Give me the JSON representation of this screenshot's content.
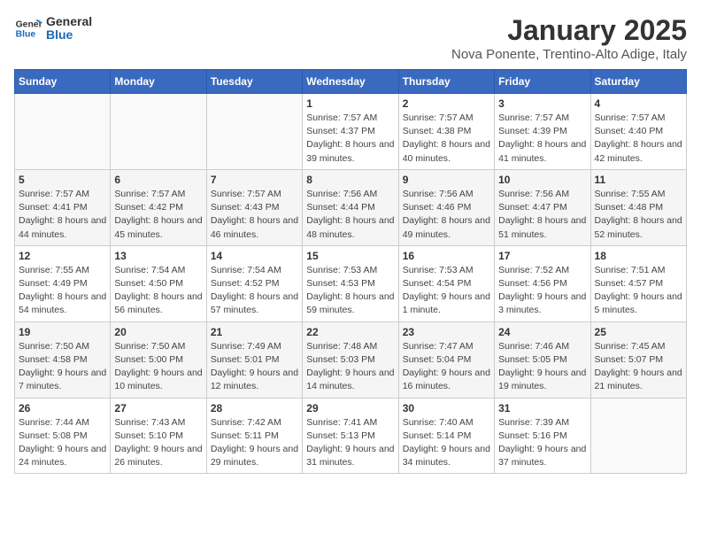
{
  "logo": {
    "line1": "General",
    "line2": "Blue"
  },
  "title": "January 2025",
  "subtitle": "Nova Ponente, Trentino-Alto Adige, Italy",
  "weekdays": [
    "Sunday",
    "Monday",
    "Tuesday",
    "Wednesday",
    "Thursday",
    "Friday",
    "Saturday"
  ],
  "weeks": [
    [
      {
        "day": "",
        "info": ""
      },
      {
        "day": "",
        "info": ""
      },
      {
        "day": "",
        "info": ""
      },
      {
        "day": "1",
        "info": "Sunrise: 7:57 AM\nSunset: 4:37 PM\nDaylight: 8 hours and 39 minutes."
      },
      {
        "day": "2",
        "info": "Sunrise: 7:57 AM\nSunset: 4:38 PM\nDaylight: 8 hours and 40 minutes."
      },
      {
        "day": "3",
        "info": "Sunrise: 7:57 AM\nSunset: 4:39 PM\nDaylight: 8 hours and 41 minutes."
      },
      {
        "day": "4",
        "info": "Sunrise: 7:57 AM\nSunset: 4:40 PM\nDaylight: 8 hours and 42 minutes."
      }
    ],
    [
      {
        "day": "5",
        "info": "Sunrise: 7:57 AM\nSunset: 4:41 PM\nDaylight: 8 hours and 44 minutes."
      },
      {
        "day": "6",
        "info": "Sunrise: 7:57 AM\nSunset: 4:42 PM\nDaylight: 8 hours and 45 minutes."
      },
      {
        "day": "7",
        "info": "Sunrise: 7:57 AM\nSunset: 4:43 PM\nDaylight: 8 hours and 46 minutes."
      },
      {
        "day": "8",
        "info": "Sunrise: 7:56 AM\nSunset: 4:44 PM\nDaylight: 8 hours and 48 minutes."
      },
      {
        "day": "9",
        "info": "Sunrise: 7:56 AM\nSunset: 4:46 PM\nDaylight: 8 hours and 49 minutes."
      },
      {
        "day": "10",
        "info": "Sunrise: 7:56 AM\nSunset: 4:47 PM\nDaylight: 8 hours and 51 minutes."
      },
      {
        "day": "11",
        "info": "Sunrise: 7:55 AM\nSunset: 4:48 PM\nDaylight: 8 hours and 52 minutes."
      }
    ],
    [
      {
        "day": "12",
        "info": "Sunrise: 7:55 AM\nSunset: 4:49 PM\nDaylight: 8 hours and 54 minutes."
      },
      {
        "day": "13",
        "info": "Sunrise: 7:54 AM\nSunset: 4:50 PM\nDaylight: 8 hours and 56 minutes."
      },
      {
        "day": "14",
        "info": "Sunrise: 7:54 AM\nSunset: 4:52 PM\nDaylight: 8 hours and 57 minutes."
      },
      {
        "day": "15",
        "info": "Sunrise: 7:53 AM\nSunset: 4:53 PM\nDaylight: 8 hours and 59 minutes."
      },
      {
        "day": "16",
        "info": "Sunrise: 7:53 AM\nSunset: 4:54 PM\nDaylight: 9 hours and 1 minute."
      },
      {
        "day": "17",
        "info": "Sunrise: 7:52 AM\nSunset: 4:56 PM\nDaylight: 9 hours and 3 minutes."
      },
      {
        "day": "18",
        "info": "Sunrise: 7:51 AM\nSunset: 4:57 PM\nDaylight: 9 hours and 5 minutes."
      }
    ],
    [
      {
        "day": "19",
        "info": "Sunrise: 7:50 AM\nSunset: 4:58 PM\nDaylight: 9 hours and 7 minutes."
      },
      {
        "day": "20",
        "info": "Sunrise: 7:50 AM\nSunset: 5:00 PM\nDaylight: 9 hours and 10 minutes."
      },
      {
        "day": "21",
        "info": "Sunrise: 7:49 AM\nSunset: 5:01 PM\nDaylight: 9 hours and 12 minutes."
      },
      {
        "day": "22",
        "info": "Sunrise: 7:48 AM\nSunset: 5:03 PM\nDaylight: 9 hours and 14 minutes."
      },
      {
        "day": "23",
        "info": "Sunrise: 7:47 AM\nSunset: 5:04 PM\nDaylight: 9 hours and 16 minutes."
      },
      {
        "day": "24",
        "info": "Sunrise: 7:46 AM\nSunset: 5:05 PM\nDaylight: 9 hours and 19 minutes."
      },
      {
        "day": "25",
        "info": "Sunrise: 7:45 AM\nSunset: 5:07 PM\nDaylight: 9 hours and 21 minutes."
      }
    ],
    [
      {
        "day": "26",
        "info": "Sunrise: 7:44 AM\nSunset: 5:08 PM\nDaylight: 9 hours and 24 minutes."
      },
      {
        "day": "27",
        "info": "Sunrise: 7:43 AM\nSunset: 5:10 PM\nDaylight: 9 hours and 26 minutes."
      },
      {
        "day": "28",
        "info": "Sunrise: 7:42 AM\nSunset: 5:11 PM\nDaylight: 9 hours and 29 minutes."
      },
      {
        "day": "29",
        "info": "Sunrise: 7:41 AM\nSunset: 5:13 PM\nDaylight: 9 hours and 31 minutes."
      },
      {
        "day": "30",
        "info": "Sunrise: 7:40 AM\nSunset: 5:14 PM\nDaylight: 9 hours and 34 minutes."
      },
      {
        "day": "31",
        "info": "Sunrise: 7:39 AM\nSunset: 5:16 PM\nDaylight: 9 hours and 37 minutes."
      },
      {
        "day": "",
        "info": ""
      }
    ]
  ]
}
